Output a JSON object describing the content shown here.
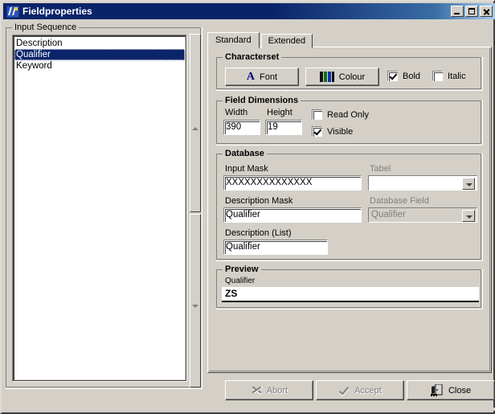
{
  "window": {
    "title": "Fieldproperties",
    "icon": "app-icon",
    "buttons": {
      "minimize": "minimize-icon",
      "maximize": "maximize-icon",
      "close": "close-icon"
    }
  },
  "input_sequence": {
    "group_label": "Input Sequence",
    "items": [
      {
        "label": "Description",
        "selected": false
      },
      {
        "label": "Qualifier",
        "selected": true
      },
      {
        "label": "Keyword",
        "selected": false
      }
    ]
  },
  "tabs": [
    {
      "label": "Standard",
      "active": true
    },
    {
      "label": "Extended",
      "active": false
    }
  ],
  "charset": {
    "group_label": "Characterset",
    "font_button": "Font",
    "colour_button": "Colour",
    "bold": {
      "label": "Bold",
      "checked": true
    },
    "italic": {
      "label": "Italic",
      "checked": false
    }
  },
  "field_dimensions": {
    "group_label": "Field Dimensions",
    "width": {
      "label": "Width",
      "value": "390"
    },
    "height": {
      "label": "Height",
      "value": "19"
    },
    "read_only": {
      "label": "Read Only",
      "checked": false
    },
    "visible": {
      "label": "Visible",
      "checked": true
    }
  },
  "database": {
    "group_label": "Database",
    "input_mask": {
      "label": "Input Mask",
      "value": "XXXXXXXXXXXXXX"
    },
    "tabel": {
      "label": "Tabel",
      "value": "",
      "disabled": true
    },
    "description_mask": {
      "label": "Description Mask",
      "value": "Qualifier"
    },
    "database_field": {
      "label": "Database Field",
      "value": "Qualifier",
      "disabled": true
    },
    "description_list": {
      "label": "Description (List)",
      "value": "Qualifier"
    }
  },
  "preview": {
    "group_label": "Preview",
    "field_label": "Qualifier",
    "field_value": "ZS"
  },
  "footer": {
    "abort": {
      "label": "Abort",
      "icon": "abort-x-icon",
      "disabled": true
    },
    "accept": {
      "label": "Accept",
      "icon": "accept-check-icon",
      "disabled": true
    },
    "close": {
      "label": "Close",
      "icon": "exit-door-icon",
      "disabled": false
    }
  },
  "colors": {
    "face": "#d4d0c8",
    "title_active": "#0a246a",
    "selection": "#0a246a",
    "disabled_text": "#808080",
    "font_icon": "#000080"
  }
}
